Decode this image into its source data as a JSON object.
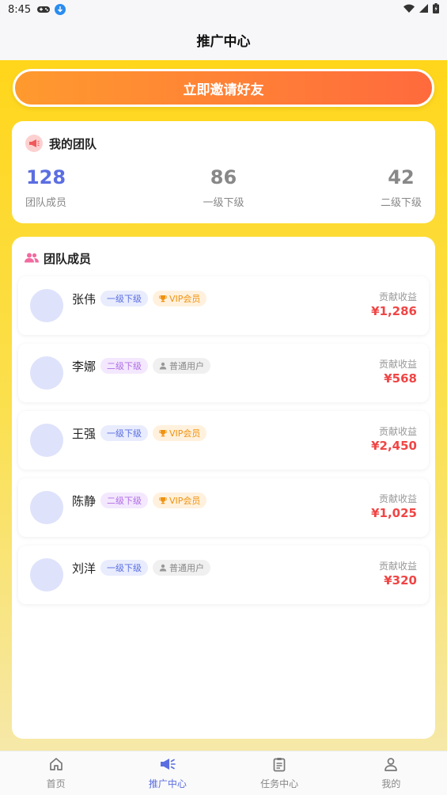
{
  "status_bar": {
    "time": "8:45",
    "left_icons": [
      "gamepad-icon",
      "download-icon"
    ],
    "right_icons": [
      "wifi-icon",
      "signal-icon",
      "battery-icon"
    ]
  },
  "header": {
    "title": "推广中心"
  },
  "invite_button": {
    "label": "立即邀请好友"
  },
  "team": {
    "title": "我的团队",
    "icon": "megaphone-icon",
    "stats": {
      "total": {
        "value": "128",
        "label": "团队成员"
      },
      "level1": {
        "value": "86",
        "label": "一级下级"
      },
      "level2": {
        "value": "42",
        "label": "二级下级"
      }
    }
  },
  "members": {
    "title": "团队成员",
    "icon": "people-icon",
    "items": [
      {
        "name": "张伟",
        "level": "一级下级",
        "type": "VIP会员",
        "contrib_label": "贡献收益",
        "contrib_value": "¥1,286"
      },
      {
        "name": "李娜",
        "level": "二级下级",
        "type": "普通用户",
        "contrib_label": "贡献收益",
        "contrib_value": "¥568"
      },
      {
        "name": "王强",
        "level": "一级下级",
        "type": "VIP会员",
        "contrib_label": "贡献收益",
        "contrib_value": "¥2,450"
      },
      {
        "name": "陈静",
        "level": "二级下级",
        "type": "VIP会员",
        "contrib_label": "贡献收益",
        "contrib_value": "¥1,025"
      },
      {
        "name": "刘洋",
        "level": "一级下级",
        "type": "普通用户",
        "contrib_label": "贡献收益",
        "contrib_value": "¥320"
      }
    ]
  },
  "tabbar": {
    "items": [
      {
        "label": "首页",
        "icon": "home-icon",
        "active": false
      },
      {
        "label": "推广中心",
        "icon": "megaphone-icon",
        "active": true
      },
      {
        "label": "任务中心",
        "icon": "clipboard-icon",
        "active": false
      },
      {
        "label": "我的",
        "icon": "user-icon",
        "active": false
      }
    ]
  },
  "colors": {
    "accent": "#5b6ee1",
    "invite_gradient_start": "#ff9a2e",
    "invite_gradient_end": "#ff6a3d",
    "background_gradient_top": "#ffd61a",
    "contrib_value": "#f04545"
  }
}
